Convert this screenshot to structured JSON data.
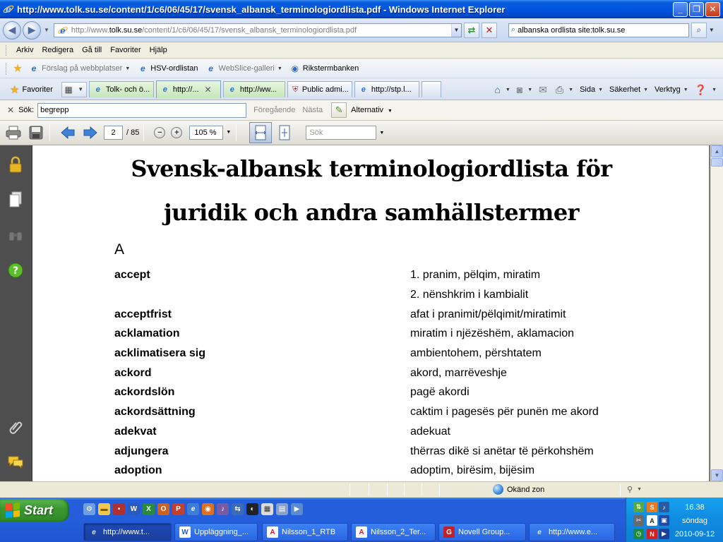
{
  "window": {
    "title": "http://www.tolk.su.se/content/1/c6/06/45/17/svensk_albansk_terminologiordlista.pdf - Windows Internet Explorer"
  },
  "address": {
    "url_prefix": "http://www.",
    "url_host": "tolk.su.se",
    "url_path": "/content/1/c6/06/45/17/svensk_albansk_terminologiordlista.pdf",
    "search_value": "albanska ordlista site:tolk.su.se"
  },
  "menu": [
    "Arkiv",
    "Redigera",
    "Gå till",
    "Favoriter",
    "Hjälp"
  ],
  "links": [
    {
      "label": "Förslag på webbplatser",
      "icon": "ie-icon",
      "muted": true,
      "dropdown": true
    },
    {
      "label": "HSV-ordlistan",
      "icon": "ie-icon",
      "muted": false,
      "dropdown": false
    },
    {
      "label": "WebSlice-galleri",
      "icon": "ie-icon",
      "muted": true,
      "dropdown": true
    },
    {
      "label": "Rikstermbanken",
      "icon": "globe-icon",
      "muted": false,
      "dropdown": false
    }
  ],
  "tabs": {
    "favorites_label": "Favoriter",
    "items": [
      {
        "label": "Tolk- och ö...",
        "style": "green",
        "active": false
      },
      {
        "label": "http://...",
        "style": "green",
        "active": true
      },
      {
        "label": "http://ww...",
        "style": "green",
        "active": false
      },
      {
        "label": "Public admi...",
        "style": "normal",
        "active": false
      },
      {
        "label": "http://stp.l...",
        "style": "normal",
        "active": false
      }
    ],
    "commands": [
      "Sida",
      "Säkerhet",
      "Verktyg"
    ]
  },
  "findbar": {
    "label": "Sök:",
    "value": "begrepp",
    "prev": "Föregående",
    "next": "Nästa",
    "options": "Alternativ"
  },
  "pdf_toolbar": {
    "page_current": "2",
    "page_total": "/ 85",
    "zoom": "105 %",
    "search_placeholder": "Sök"
  },
  "document": {
    "title_line1": "Svensk-albansk terminologiordlista för",
    "title_line2": "juridik och andra samhällstermer",
    "section_letter": "A",
    "entries": [
      {
        "sv": "accept",
        "sq": "1. pranim, pëlqim, miratim"
      },
      {
        "sv": "",
        "sq": "2. nënshkrim i kambialit"
      },
      {
        "sv": "acceptfrist",
        "sq": "afat i pranimit/pëlqimit/miratimit"
      },
      {
        "sv": "acklamation",
        "sq": "miratim i njëzëshëm, aklamacion"
      },
      {
        "sv": "acklimatisera sig",
        "sq": "ambientohem, përshtatem"
      },
      {
        "sv": "ackord",
        "sq": "akord, marrëveshje"
      },
      {
        "sv": "ackordslön",
        "sq": "pagë akordi"
      },
      {
        "sv": "ackordsättning",
        "sq": "caktim i pagesës për punën me akord"
      },
      {
        "sv": "adekvat",
        "sq": "adekuat"
      },
      {
        "sv": "adjungera",
        "sq": "thërras dikë si anëtar të përkohshëm"
      },
      {
        "sv": "adoption",
        "sq": "adoptim, birësim, bijësim"
      }
    ]
  },
  "statusbar": {
    "zone": "Okänd zon"
  },
  "taskbar": {
    "start_label": "Start",
    "buttons": [
      {
        "label": "http://www.t...",
        "icon": "ie-icon",
        "active": true
      },
      {
        "label": "Uppläggning_...",
        "icon": "word-icon",
        "active": false
      },
      {
        "label": "Nilsson_1_RTB",
        "icon": "pdf-icon",
        "active": false
      },
      {
        "label": "Nilsson_2_Ter...",
        "icon": "pdf-icon",
        "active": false
      },
      {
        "label": "Novell Group...",
        "icon": "groupwise-icon",
        "active": false
      },
      {
        "label": "http://www.e...",
        "icon": "ie-icon",
        "active": false
      }
    ],
    "clock_time": "16.38",
    "clock_day": "söndag",
    "clock_date": "2010-09-12"
  },
  "colors": {
    "titlebar": "#0054e3",
    "taskbar": "#245edb",
    "start": "#3c9a32",
    "pdf_sidebar": "#4e4e4e"
  }
}
